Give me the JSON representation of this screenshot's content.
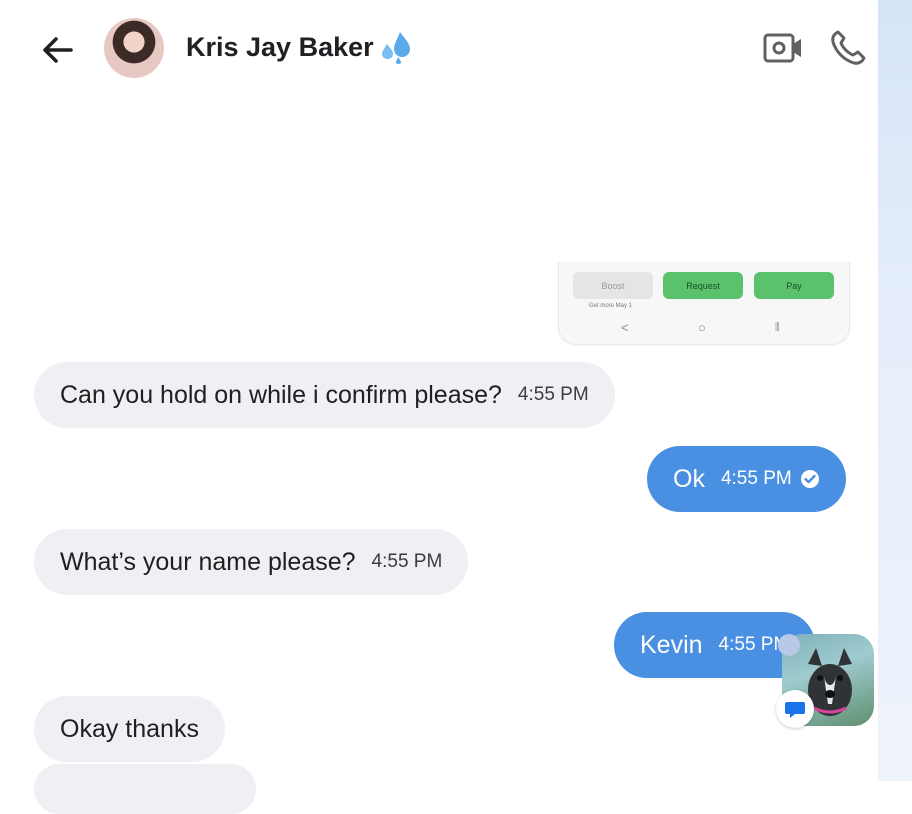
{
  "header": {
    "contact_name": "Kris Jay Baker",
    "emoji_icon": "sweat-droplets-icon",
    "back_icon": "arrow-left-icon",
    "video_icon": "video-camera-icon",
    "phone_icon": "phone-icon"
  },
  "attached_screenshot": {
    "buttons": [
      "Boost",
      "Request",
      "Pay"
    ],
    "caption": "Get more May 1",
    "nav": [
      "<",
      "○",
      "⫼"
    ]
  },
  "messages": [
    {
      "direction": "incoming",
      "text": "Can you hold on while i confirm please?",
      "time": "4:55 PM"
    },
    {
      "direction": "outgoing",
      "text": "Ok",
      "time": "4:55 PM",
      "status_icon": "check-circle-icon"
    },
    {
      "direction": "incoming",
      "text": "What’s your name please?",
      "time": "4:55 PM"
    },
    {
      "direction": "outgoing",
      "text": "Kevin",
      "time": "4:55 PM"
    },
    {
      "direction": "incoming",
      "text": "Okay thanks",
      "time": ""
    }
  ],
  "colors": {
    "outgoing_bubble": "#4a90e2",
    "incoming_bubble": "#eef0f4",
    "request_green": "#5ac26d"
  },
  "chat_head": {
    "icon": "dog-avatar-icon",
    "badge_icon": "message-bubble-icon"
  }
}
